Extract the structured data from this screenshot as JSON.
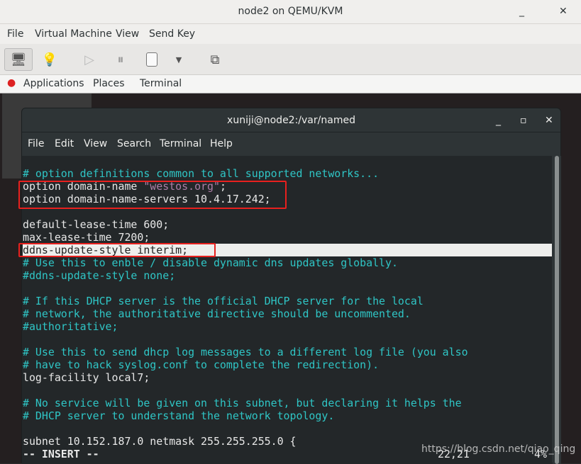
{
  "window": {
    "title": "node2 on QEMU/KVM",
    "minimize": "_",
    "close": "✕"
  },
  "menubar": [
    "File",
    "Virtual Machine",
    "View",
    "Send Key"
  ],
  "toolbar": {
    "icons": [
      "monitor-icon",
      "lightbulb-icon",
      "play-icon",
      "pause-icon",
      "power-icon",
      "dropdown-icon",
      "screens-icon"
    ]
  },
  "gnome": {
    "applications": "Applications",
    "places": "Places",
    "terminal": "Terminal"
  },
  "terminal": {
    "title": "xuniji@node2:/var/named",
    "menu": [
      "File",
      "Edit",
      "View",
      "Search",
      "Terminal",
      "Help"
    ],
    "lines": [
      {
        "text": "# option definitions common to all supported networks...",
        "type": "comment"
      },
      {
        "pre": "option domain-name ",
        "str": "\"westos.org\"",
        "post": ";",
        "type": "mixed"
      },
      {
        "text": "option domain-name-servers 10.4.17.242;",
        "type": "code"
      },
      {
        "text": "",
        "type": "code"
      },
      {
        "text": "default-lease-time 600;",
        "type": "code"
      },
      {
        "text": "max-lease-time 7200;",
        "type": "code"
      },
      {
        "text": "ddns-update-style interim;",
        "type": "highlight"
      },
      {
        "text": "# Use this to enble / disable dynamic dns updates globally.",
        "type": "comment"
      },
      {
        "text": "#ddns-update-style none;",
        "type": "comment"
      },
      {
        "text": "",
        "type": "code"
      },
      {
        "text": "# If this DHCP server is the official DHCP server for the local",
        "type": "comment"
      },
      {
        "text": "# network, the authoritative directive should be uncommented.",
        "type": "comment"
      },
      {
        "text": "#authoritative;",
        "type": "comment"
      },
      {
        "text": "",
        "type": "code"
      },
      {
        "text": "# Use this to send dhcp log messages to a different log file (you also",
        "type": "comment"
      },
      {
        "text": "# have to hack syslog.conf to complete the redirection).",
        "type": "comment"
      },
      {
        "text": "log-facility local7;",
        "type": "code"
      },
      {
        "text": "",
        "type": "code"
      },
      {
        "text": "# No service will be given on this subnet, but declaring it helps the",
        "type": "comment"
      },
      {
        "text": "# DHCP server to understand the network topology.",
        "type": "comment"
      },
      {
        "text": "",
        "type": "code"
      },
      {
        "text": "subnet 10.152.187.0 netmask 255.255.255.0 {",
        "type": "code"
      }
    ],
    "status": {
      "mode": "-- INSERT --",
      "position": "22,21",
      "percent": "4%"
    }
  },
  "watermark": "https://blog.csdn.net/qiao_qing"
}
